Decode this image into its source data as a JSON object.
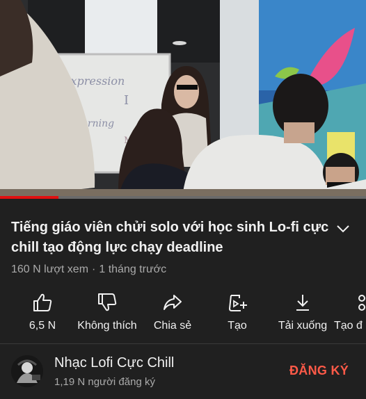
{
  "video": {
    "board_text": [
      "expression",
      "I",
      "Learning",
      "Mode"
    ],
    "progress_fraction": 0.16
  },
  "title": "Tiếng giáo viên chửi solo với học sinh Lo-fi cực chill tạo động lực chạy deadline",
  "meta": {
    "views": "160 N lượt xem",
    "separator": "·",
    "time": "1 tháng trước"
  },
  "actions": [
    {
      "icon": "thumbs-up-icon",
      "label": "6,5 N"
    },
    {
      "icon": "thumbs-down-icon",
      "label": "Không thích"
    },
    {
      "icon": "share-icon",
      "label": "Chia sẻ"
    },
    {
      "icon": "create-icon",
      "label": "Tạo"
    },
    {
      "icon": "download-icon",
      "label": "Tải xuống"
    },
    {
      "icon": "clip-icon",
      "label": "Tạo đ"
    }
  ],
  "channel": {
    "name": "Nhạc Lofi Cực Chill",
    "subscribers": "1,19 N người đăng ký",
    "subscribe_label": "ĐĂNG KÝ"
  },
  "colors": {
    "accent": "#ff5a48",
    "progress": "#e01010",
    "background": "#202020"
  }
}
